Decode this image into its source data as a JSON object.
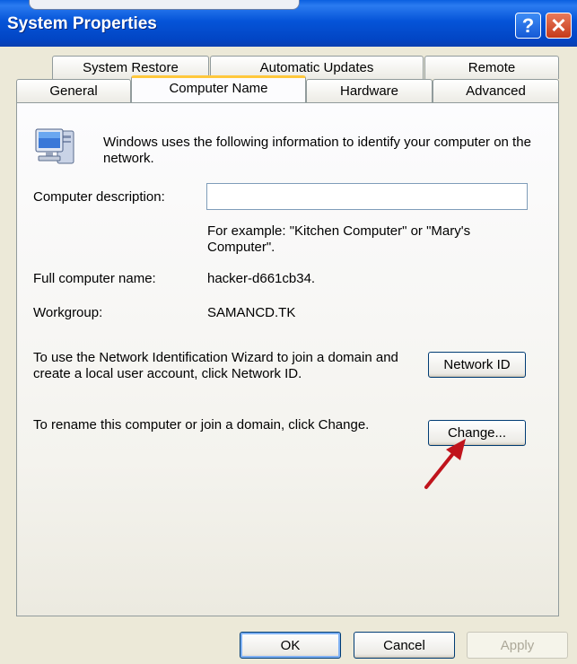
{
  "window": {
    "title": "System Properties",
    "help_label": "?",
    "close_label": "✕"
  },
  "tabs": {
    "row1": [
      "System Restore",
      "Automatic Updates",
      "Remote"
    ],
    "row2": [
      "General",
      "Computer Name",
      "Hardware",
      "Advanced"
    ],
    "active": "Computer Name"
  },
  "content": {
    "intro": "Windows uses the following information to identify your computer on the network.",
    "description_label": "Computer description:",
    "description_value": "",
    "description_example": "For example: \"Kitchen Computer\" or \"Mary's Computer\".",
    "full_name_label": "Full computer name:",
    "full_name_value": "hacker-d661cb34.",
    "workgroup_label": "Workgroup:",
    "workgroup_value": "SAMANCD.TK",
    "network_id_text": "To use the Network Identification Wizard to join a domain and create a local user account, click Network ID.",
    "network_id_button": "Network ID",
    "rename_text": "To rename this computer or join a domain, click Change.",
    "change_button": "Change..."
  },
  "footer": {
    "ok": "OK",
    "cancel": "Cancel",
    "apply": "Apply"
  },
  "icons": {
    "computer": "computer-icon",
    "arrow": "red-arrow-annotation"
  },
  "colors": {
    "titlebar": "#0554d8",
    "dialog_bg": "#ece9d8",
    "tab_highlight": "#ffc83c",
    "arrow": "#c0141c"
  }
}
